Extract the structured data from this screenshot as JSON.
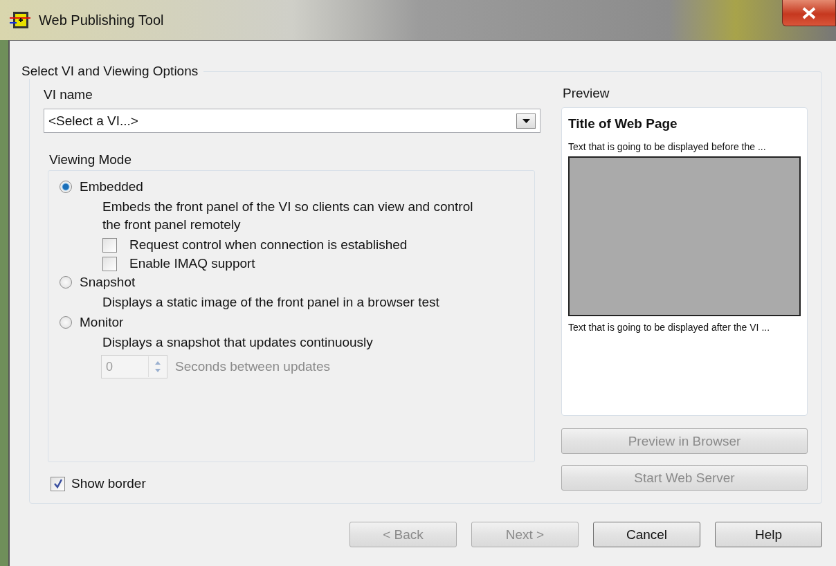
{
  "window": {
    "title": "Web Publishing Tool"
  },
  "group": {
    "title": "Select VI and Viewing Options"
  },
  "vi_name": {
    "label": "VI name",
    "value": "<Select a VI...>"
  },
  "viewing_mode": {
    "label": "Viewing Mode",
    "options": [
      {
        "label": "Embedded",
        "selected": true,
        "description": "Embeds the front panel of the VI so clients can view and control the front panel remotely",
        "checkboxes": [
          {
            "label": "Request control when connection is established",
            "checked": false
          },
          {
            "label": "Enable IMAQ support",
            "checked": false
          }
        ]
      },
      {
        "label": "Snapshot",
        "selected": false,
        "description": "Displays a static image of the front panel in a browser test"
      },
      {
        "label": "Monitor",
        "selected": false,
        "description": "Displays a snapshot that updates continuously",
        "spin": {
          "value": "0",
          "label": "Seconds between updates",
          "disabled": true
        }
      }
    ]
  },
  "show_border": {
    "label": "Show border",
    "checked": true
  },
  "preview": {
    "label": "Preview",
    "title": "Title of Web Page",
    "text_before": "Text that is going to be displayed before the ...",
    "text_after": "Text that is going to be displayed after the VI ..."
  },
  "side_buttons": [
    {
      "label": "Preview in Browser",
      "disabled": true
    },
    {
      "label": "Start Web Server",
      "disabled": true
    }
  ],
  "footer_buttons": [
    {
      "label": "< Back",
      "disabled": true
    },
    {
      "label": "Next >",
      "disabled": true
    },
    {
      "label": "Cancel",
      "disabled": false
    },
    {
      "label": "Help",
      "disabled": false
    }
  ]
}
